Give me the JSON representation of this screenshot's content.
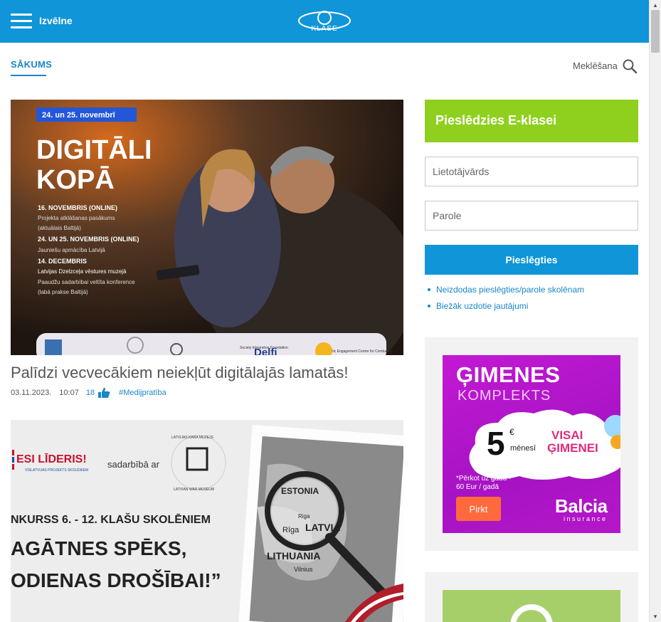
{
  "header": {
    "menu_label": "Izvēlne",
    "logo_text": "KLASE",
    "bg_color": "#0f95d8"
  },
  "nav": {
    "home": "SĀKUMS",
    "search_label": "Meklēšana"
  },
  "articles": [
    {
      "poster": {
        "date_badge": "24. un 25. novembrī",
        "headline_1": "DIGITĀLI",
        "headline_2": "KOPĀ",
        "l1": "16. NOVEMBRIS (ONLINE)",
        "l2": "Projekta atklāšanas pasākums",
        "l3": "(aktuālais Baltijā)",
        "l4": "24. UN 25. NOVEMBRIS (ONLINE)",
        "l5": "Jauniešu apmācība Latvijā",
        "l6": "14. DECEMBRIS",
        "l7": "Latvijas Dzelzceļa vēstures muzejā",
        "l8": "Paaudžu sadarbībai veltīta konference",
        "l9": "(labā prakse Baltijā)",
        "sponsor_1": "Society Integration Foundation",
        "sponsor_2": "Delfi",
        "sponsor_3": "Baltic Engagement Centre for Combating"
      },
      "title": "Palīdzi vecvecākiem neiekļūt digitālajās lamatās!",
      "date": "03.11.2023.",
      "time": "10:07",
      "likes": "18",
      "tag": "#Medijpratība"
    },
    {
      "poster": {
        "badge_1": "ESI LĪDERIS!",
        "badge_sub": "VISLATVIJAS PROJEKTS SKOLĒNIEM",
        "with": "sadarbībā ar",
        "museum": "LATVIJAS KARA MUZEJS",
        "museum_en": "LATVIAN WAR MUSEUM",
        "line1": "NKURSS 6. - 12. KLAŠU SKOLĒNIEM",
        "line2": "AGĀTNES SPĒKS,",
        "line3": "ODIENAS DROŠĪBAI!”",
        "map_1": "ESTONIA",
        "map_2": "Rīga",
        "map_3": "LATVIA",
        "map_4": "LITHUANIA",
        "map_5": "Vilnius",
        "map_6": "Riga"
      }
    }
  ],
  "login": {
    "title": "Pieslēdzies E-klasei",
    "username_placeholder": "Lietotājvārds",
    "password_placeholder": "Parole",
    "submit": "Pieslēgties",
    "links": [
      "Neizdodas pieslēgties/parole skolēnam",
      "Biežāk uzdotie jautājumi"
    ],
    "head_color": "#8fd01e"
  },
  "ad": {
    "title_1": "ĢIMENES",
    "title_2": "KOMPLEKTS",
    "price": "5",
    "currency": "€",
    "period": "mēnesī",
    "visai_1": "VISAI",
    "visai_2": "ĢIMENEI",
    "note_1": "*Pērkot uz gadu -",
    "note_2": "60 Eur / gadā",
    "button": "Pirkt",
    "brand": "Balcia",
    "brand_sub": "insurance"
  }
}
